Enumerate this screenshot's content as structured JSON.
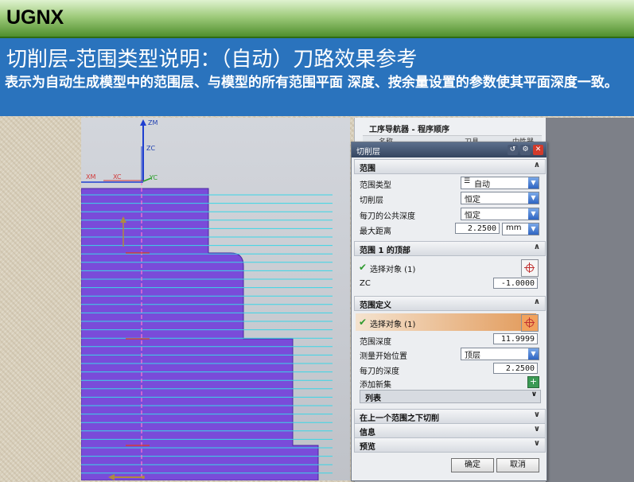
{
  "slide": {
    "brand": "UGNX",
    "title": "切削层-范围类型说明：（自动）刀路效果参考",
    "description": "表示为自动生成模型中的范围层、与模型的所有范围平面 深度、按余量设置的参数使其平面深度一致。"
  },
  "viewport": {
    "axes": {
      "zm": "ZM",
      "zc": "ZC",
      "xm": "XM",
      "xc": "XC",
      "yc": "YC"
    },
    "colors": {
      "part": "#7a4bd9",
      "toolpath": "#3ad6e6",
      "axis": "#1f3fd0"
    }
  },
  "navigator": {
    "title": "工序导航器 - 程序顺序",
    "columns": [
      "名称",
      "刀具",
      "中性器"
    ]
  },
  "dialog": {
    "title": "切削层",
    "sections": {
      "range": {
        "label": "范围",
        "range_type_label": "范围类型",
        "range_type_value": "自动",
        "cut_layer_label": "切削层",
        "cut_layer_value": "恒定",
        "common_depth_label": "每刀的公共深度",
        "common_depth_value": "恒定",
        "max_distance_label": "最大距离",
        "max_distance_value": "2.2500",
        "max_distance_unit": "mm"
      },
      "range1_top": {
        "label": "范围 1 的顶部",
        "select_label": "选择对象 (1)",
        "zc_label": "ZC",
        "zc_value": "-1.0000"
      },
      "range_def": {
        "label": "范围定义",
        "select_label": "选择对象 (1)",
        "range_depth_label": "范围深度",
        "range_depth_value": "11.9999",
        "measure_from_label": "测量开始位置",
        "measure_from_value": "顶层",
        "depth_per_cut_label": "每刀的深度",
        "depth_per_cut_value": "2.2500",
        "add_set_label": "添加新集",
        "list_label": "列表"
      },
      "cut_below": {
        "label": "在上一个范围之下切削"
      },
      "info": {
        "label": "信息"
      },
      "preview": {
        "label": "预览"
      }
    },
    "ok_label": "确定",
    "cancel_label": "取消"
  }
}
